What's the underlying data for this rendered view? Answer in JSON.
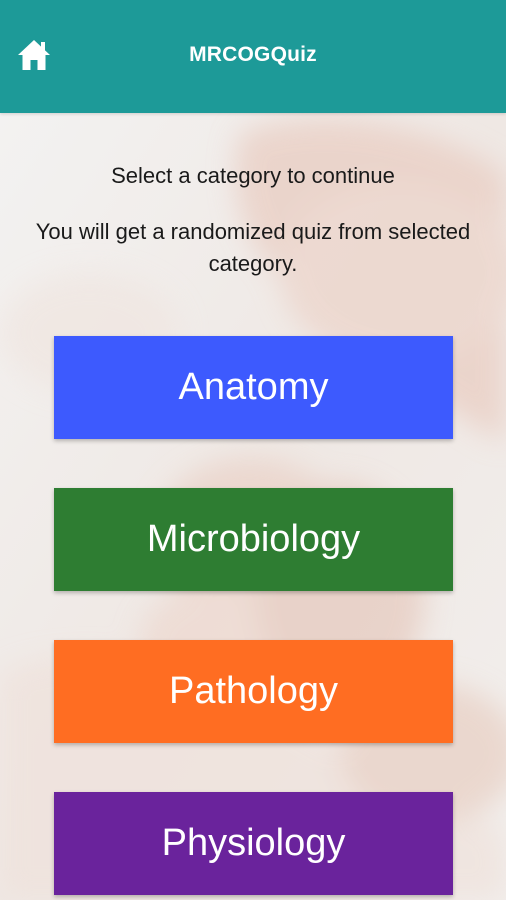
{
  "header": {
    "title": "MRCOGQuiz",
    "home_icon": "home-icon",
    "color": "#1d9a98"
  },
  "intro": {
    "line1": "Select a category to continue",
    "line2": "You will get a randomized quiz from selected category."
  },
  "categories": [
    {
      "label": "Anatomy",
      "color": "#3d5afe"
    },
    {
      "label": "Microbiology",
      "color": "#2e7d32"
    },
    {
      "label": "Pathology",
      "color": "#ff6d22"
    },
    {
      "label": "Physiology",
      "color": "#6a239c"
    }
  ]
}
